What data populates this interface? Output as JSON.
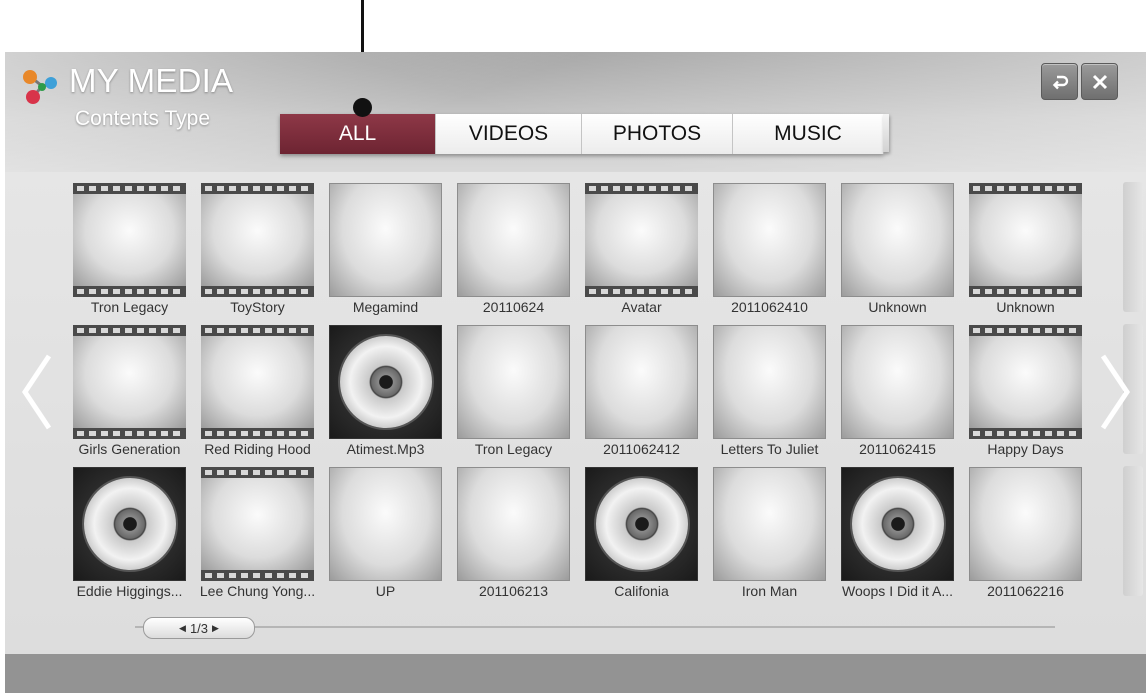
{
  "app": {
    "title": "MY MEDIA",
    "subtitle": "Contents Type"
  },
  "header_buttons": [
    {
      "icon": "back-icon"
    },
    {
      "icon": "close-icon"
    }
  ],
  "tabs": [
    {
      "label": "ALL",
      "active": true
    },
    {
      "label": "VIDEOS",
      "active": false
    },
    {
      "label": "PHOTOS",
      "active": false
    },
    {
      "label": "MUSIC",
      "active": false
    }
  ],
  "items": [
    {
      "label": "Tron Legacy",
      "kind": "video"
    },
    {
      "label": "ToyStory",
      "kind": "video"
    },
    {
      "label": "Megamind",
      "kind": "photo"
    },
    {
      "label": "20110624",
      "kind": "photo"
    },
    {
      "label": "Avatar",
      "kind": "video"
    },
    {
      "label": "2011062410",
      "kind": "photo"
    },
    {
      "label": "Unknown",
      "kind": "photo"
    },
    {
      "label": "Unknown",
      "kind": "video"
    },
    {
      "label": "Girls Generation",
      "kind": "video"
    },
    {
      "label": "Red Riding Hood",
      "kind": "video"
    },
    {
      "label": "Atimest.Mp3",
      "kind": "music"
    },
    {
      "label": "Tron Legacy",
      "kind": "photo"
    },
    {
      "label": "2011062412",
      "kind": "photo"
    },
    {
      "label": "Letters To Juliet",
      "kind": "photo"
    },
    {
      "label": "2011062415",
      "kind": "photo"
    },
    {
      "label": "Happy Days",
      "kind": "video"
    },
    {
      "label": "Eddie Higgings...",
      "kind": "music"
    },
    {
      "label": "Lee Chung Yong...",
      "kind": "video"
    },
    {
      "label": "UP",
      "kind": "photo"
    },
    {
      "label": "201106213",
      "kind": "photo"
    },
    {
      "label": "Califonia",
      "kind": "music"
    },
    {
      "label": "Iron Man",
      "kind": "photo"
    },
    {
      "label": "Woops I Did it A...",
      "kind": "music"
    },
    {
      "label": "2011062216",
      "kind": "photo"
    }
  ],
  "pagination": {
    "text": "1/3"
  },
  "colors": {
    "active_tab": "#7d2d3b",
    "footer": "#939393"
  }
}
